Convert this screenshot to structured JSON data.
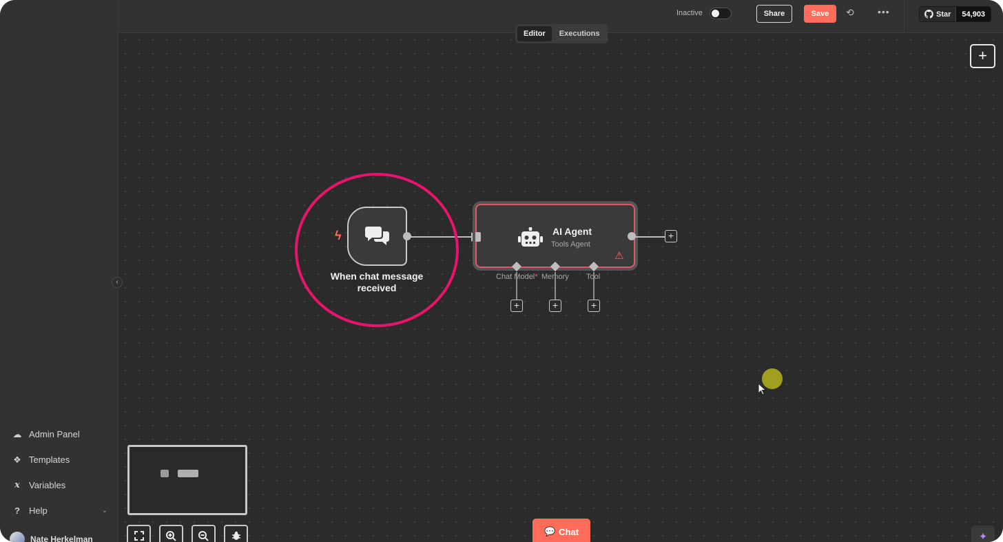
{
  "topbar": {
    "status_label": "Inactive",
    "share_label": "Share",
    "save_label": "Save",
    "github_star_label": "Star",
    "github_star_count": "54,903"
  },
  "tabs": [
    {
      "label": "Editor",
      "active": true
    },
    {
      "label": "Executions",
      "active": false
    }
  ],
  "sidebar": {
    "items": [
      {
        "label": "Admin Panel",
        "icon": "cloud-icon"
      },
      {
        "label": "Templates",
        "icon": "templates-icon"
      },
      {
        "label": "Variables",
        "icon": "variables-icon"
      },
      {
        "label": "Help",
        "icon": "help-icon"
      }
    ],
    "user_name": "Nate Herkelman"
  },
  "workflow": {
    "trigger_node": {
      "label": "When chat message received",
      "icon": "chat-bubbles-icon"
    },
    "agent_node": {
      "title": "AI Agent",
      "subtitle": "Tools Agent",
      "warning": true,
      "sub_ports": [
        {
          "label": "Chat Model",
          "required": true
        },
        {
          "label": "Memory",
          "required": false
        },
        {
          "label": "Tool",
          "required": false
        }
      ]
    }
  },
  "chat_button_label": "Chat",
  "colors": {
    "accent": "#ff6d5a",
    "highlight": "#e8146d",
    "canvas": "#2b2b2b",
    "warning": "#ff5f5f"
  }
}
